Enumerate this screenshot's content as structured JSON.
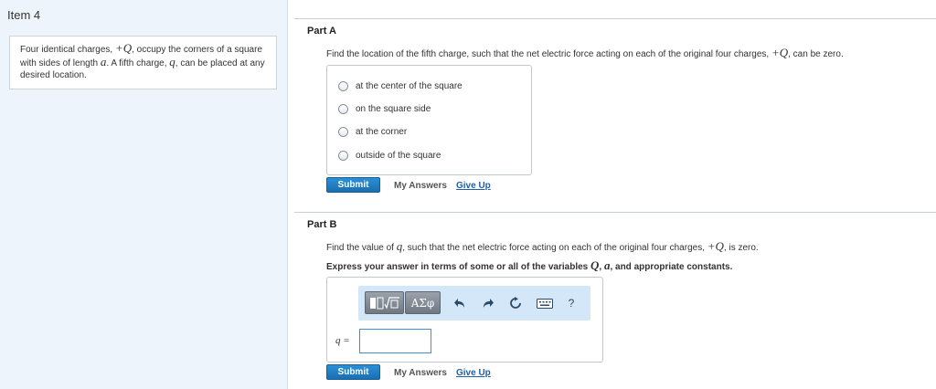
{
  "item_title": "Item 4",
  "problem": {
    "t1": "Four identical charges, ",
    "m1": "+Q",
    "t2": ", occupy the corners of a square with sides of length ",
    "m2": "a",
    "t3": ". A fifth charge, ",
    "m3": "q",
    "t4": ", can be placed at any desired location."
  },
  "part_a": {
    "label": "Part A",
    "prompt_t1": "Find the location of the fifth charge, such that the net electric force acting on each of the original four charges, ",
    "prompt_m1": "+Q",
    "prompt_t2": ", can be zero.",
    "choices": [
      "at the center of the square",
      "on the square side",
      "at the corner",
      "outside of the square"
    ],
    "submit": "Submit",
    "my_answers": "My Answers",
    "give_up": "Give Up"
  },
  "part_b": {
    "label": "Part B",
    "prompt_t1": "Find the value of ",
    "prompt_m1": "q",
    "prompt_t2": ", such that the net electric force acting on each of the original four charges, ",
    "prompt_m2": "+Q",
    "prompt_t3": ", is zero.",
    "express_t1": "Express your answer in terms of some or all of the variables ",
    "express_m1": "Q",
    "express_t2": ", ",
    "express_m2": "a",
    "express_t3": ", and appropriate constants.",
    "toolbar": {
      "templates_icon": "sqrt-template-icon",
      "symbols_label": "ΑΣφ",
      "undo_icon": "undo-icon",
      "redo_icon": "redo-icon",
      "reset_icon": "reset-icon",
      "keyboard_icon": "keyboard-icon",
      "help_label": "?"
    },
    "answer_label": "q =",
    "answer_value": "",
    "submit": "Submit",
    "my_answers": "My Answers",
    "give_up": "Give Up"
  },
  "colors": {
    "accent": "#1a6fb0",
    "link": "#1d5fa8",
    "sidebar_bg": "#eef4fb",
    "toolbar_bg": "#d3e7f8"
  }
}
